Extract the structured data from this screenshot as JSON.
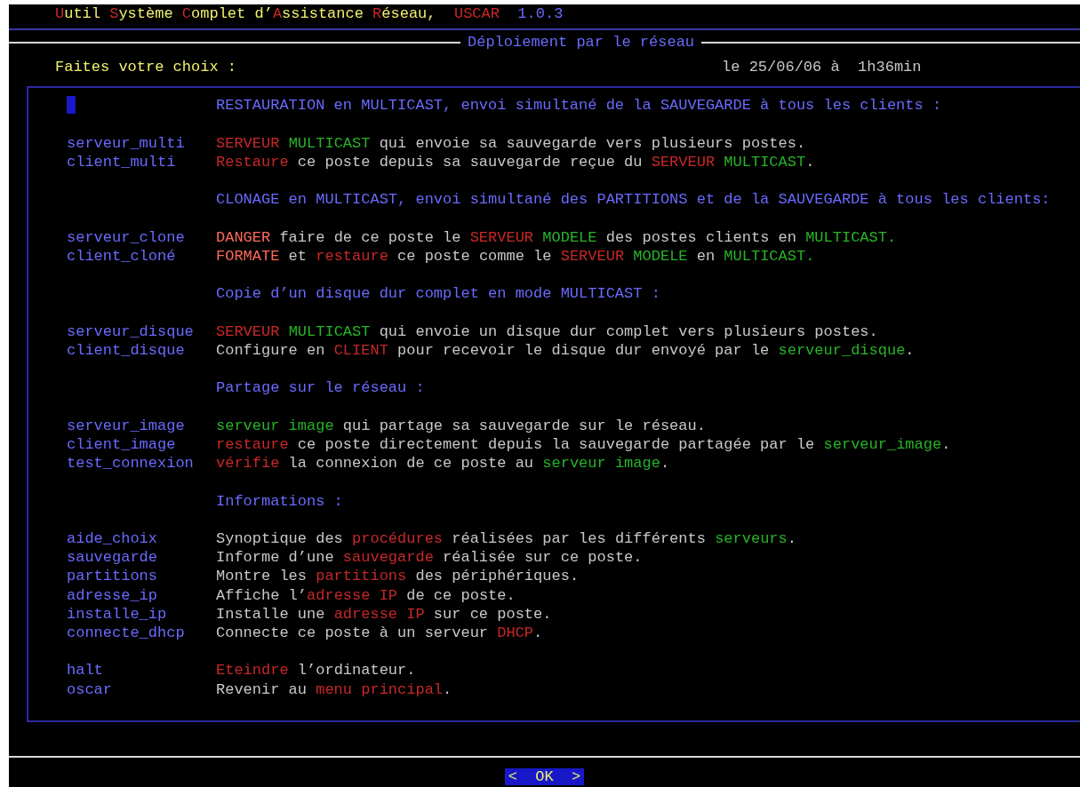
{
  "header": {
    "title": [
      {
        "text": "U",
        "kind": "initial"
      },
      {
        "text": "util ",
        "kind": "title"
      },
      {
        "text": "S",
        "kind": "initial"
      },
      {
        "text": "ystème ",
        "kind": "title"
      },
      {
        "text": "C",
        "kind": "initial"
      },
      {
        "text": "omplet d’",
        "kind": "title"
      },
      {
        "text": "A",
        "kind": "initial"
      },
      {
        "text": "ssistance ",
        "kind": "title"
      },
      {
        "text": "R",
        "kind": "initial"
      },
      {
        "text": "éseau,  ",
        "kind": "title"
      },
      {
        "text": "USCAR",
        "kind": "initial"
      },
      {
        "text": "  1.0.3",
        "kind": "version"
      }
    ]
  },
  "dialog": {
    "title": "Déploiement par le réseau",
    "prompt": "Faites votre choix :",
    "datetime": "le 25/06/06 à  1h36min",
    "groups": [
      {
        "cursor": true,
        "heading": "RESTAURATION en MULTICAST, envoi simultané de la SAUVEGARDE à tous les clients :",
        "options": [
          {
            "tag": "serveur_multi",
            "description": [
              {
                "text": "SERVEUR ",
                "kind": "alert"
              },
              {
                "text": "MULTICAST",
                "kind": "keyword"
              },
              {
                "text": " qui envoie sa sauvegarde vers plusieurs postes.",
                "kind": "plain"
              }
            ]
          },
          {
            "tag": "client_multi",
            "description": [
              {
                "text": "Restaure",
                "kind": "alert"
              },
              {
                "text": " ce poste depuis sa sauvegarde reçue du ",
                "kind": "plain"
              },
              {
                "text": "SERVEUR ",
                "kind": "alert"
              },
              {
                "text": "MULTICAST",
                "kind": "keyword"
              },
              {
                "text": ".",
                "kind": "plain"
              }
            ]
          }
        ]
      },
      {
        "cursor": false,
        "heading": "CLONAGE en MULTICAST, envoi simultané des PARTITIONS et de la SAUVEGARDE à tous les clients:",
        "options": [
          {
            "tag": "serveur_clone",
            "description": [
              {
                "text": "DANGER",
                "kind": "danger"
              },
              {
                "text": " faire de ce poste le ",
                "kind": "plain"
              },
              {
                "text": "SERVEUR ",
                "kind": "alert"
              },
              {
                "text": "MODELE",
                "kind": "keyword"
              },
              {
                "text": " des postes clients en ",
                "kind": "plain"
              },
              {
                "text": "MULTICAST.",
                "kind": "keyword"
              }
            ]
          },
          {
            "tag": "client_cloné",
            "description": [
              {
                "text": "FORMATE",
                "kind": "danger"
              },
              {
                "text": " et ",
                "kind": "plain"
              },
              {
                "text": "restaure",
                "kind": "alert"
              },
              {
                "text": " ce poste comme le ",
                "kind": "plain"
              },
              {
                "text": "SERVEUR ",
                "kind": "alert"
              },
              {
                "text": "MODELE",
                "kind": "keyword"
              },
              {
                "text": " en ",
                "kind": "plain"
              },
              {
                "text": "MULTICAST.",
                "kind": "keyword"
              }
            ]
          }
        ]
      },
      {
        "cursor": false,
        "heading": "Copie d’un disque dur complet en mode MULTICAST :",
        "options": [
          {
            "tag": "serveur_disque",
            "description": [
              {
                "text": "SERVEUR ",
                "kind": "alert"
              },
              {
                "text": "MULTICAST",
                "kind": "keyword"
              },
              {
                "text": " qui envoie un disque dur complet vers plusieurs postes.",
                "kind": "plain"
              }
            ]
          },
          {
            "tag": "client_disque",
            "description": [
              {
                "text": "Configure en ",
                "kind": "plain"
              },
              {
                "text": "CLIENT",
                "kind": "alert"
              },
              {
                "text": " pour recevoir le disque dur envoyé par le ",
                "kind": "plain"
              },
              {
                "text": "serveur_disque",
                "kind": "keyword"
              },
              {
                "text": ".",
                "kind": "plain"
              }
            ]
          }
        ]
      },
      {
        "cursor": false,
        "heading": "Partage sur le réseau :",
        "options": [
          {
            "tag": "serveur_image",
            "description": [
              {
                "text": "serveur image",
                "kind": "keyword"
              },
              {
                "text": " qui partage sa sauvegarde sur le réseau.",
                "kind": "plain"
              }
            ]
          },
          {
            "tag": "client_image",
            "description": [
              {
                "text": "restaure",
                "kind": "alert"
              },
              {
                "text": " ce poste directement depuis la sauvegarde partagée par le ",
                "kind": "plain"
              },
              {
                "text": "serveur_image",
                "kind": "keyword"
              },
              {
                "text": ".",
                "kind": "plain"
              }
            ]
          },
          {
            "tag": "test_connexion",
            "description": [
              {
                "text": "vérifie",
                "kind": "alert"
              },
              {
                "text": " la connexion de ce poste au ",
                "kind": "plain"
              },
              {
                "text": "serveur image",
                "kind": "keyword"
              },
              {
                "text": ".",
                "kind": "plain"
              }
            ]
          }
        ]
      },
      {
        "cursor": false,
        "heading": "Informations :",
        "options": [
          {
            "tag": "aide_choix",
            "description": [
              {
                "text": "Synoptique des ",
                "kind": "plain"
              },
              {
                "text": "procédures",
                "kind": "alert"
              },
              {
                "text": " réalisées par les différents ",
                "kind": "plain"
              },
              {
                "text": "serveurs",
                "kind": "keyword"
              },
              {
                "text": ".",
                "kind": "plain"
              }
            ]
          },
          {
            "tag": "sauvegarde",
            "description": [
              {
                "text": "Informe d’une ",
                "kind": "plain"
              },
              {
                "text": "sauvegarde",
                "kind": "alert"
              },
              {
                "text": " réalisée sur ce poste.",
                "kind": "plain"
              }
            ]
          },
          {
            "tag": "partitions",
            "description": [
              {
                "text": "Montre les ",
                "kind": "plain"
              },
              {
                "text": "partitions",
                "kind": "alert"
              },
              {
                "text": " des périphériques.",
                "kind": "plain"
              }
            ]
          },
          {
            "tag": "adresse_ip",
            "description": [
              {
                "text": "Affiche l’",
                "kind": "plain"
              },
              {
                "text": "adresse IP",
                "kind": "alert"
              },
              {
                "text": " de ce poste.",
                "kind": "plain"
              }
            ]
          },
          {
            "tag": "installe_ip",
            "description": [
              {
                "text": "Installe une ",
                "kind": "plain"
              },
              {
                "text": "adresse IP",
                "kind": "alert"
              },
              {
                "text": " sur ce poste.",
                "kind": "plain"
              }
            ]
          },
          {
            "tag": "connecte_dhcp",
            "description": [
              {
                "text": "Connecte ce poste à un serveur ",
                "kind": "plain"
              },
              {
                "text": "DHCP",
                "kind": "alert"
              },
              {
                "text": ".",
                "kind": "plain"
              }
            ]
          }
        ]
      },
      {
        "options": [
          {
            "tag": "halt",
            "description": [
              {
                "text": "Eteindre",
                "kind": "alert"
              },
              {
                "text": " l’ordinateur.",
                "kind": "plain"
              }
            ]
          },
          {
            "tag": "oscar",
            "description": [
              {
                "text": "Revenir au ",
                "kind": "plain"
              },
              {
                "text": "menu principal",
                "kind": "alert"
              },
              {
                "text": ".",
                "kind": "plain"
              }
            ]
          }
        ]
      }
    ]
  },
  "buttons": [
    {
      "label": "<  OK  >",
      "selected": true
    }
  ]
}
